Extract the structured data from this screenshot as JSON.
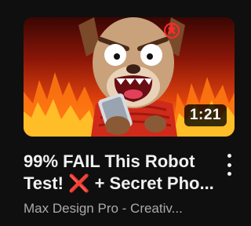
{
  "video": {
    "duration": "1:21",
    "title_line1": "99% FAIL This Robot",
    "title_line2_pre": "Test! ",
    "title_line2_icon": "❌",
    "title_line2_post": " + Secret Pho...",
    "channel": "Max Design Pro - Creativ...",
    "more_icon": "three-dot-vertical-icon"
  },
  "colors": {
    "background": "#0f0f0f",
    "title": "#f1f1f1",
    "channel": "#aaaaaa",
    "cross": "#e0202e"
  }
}
